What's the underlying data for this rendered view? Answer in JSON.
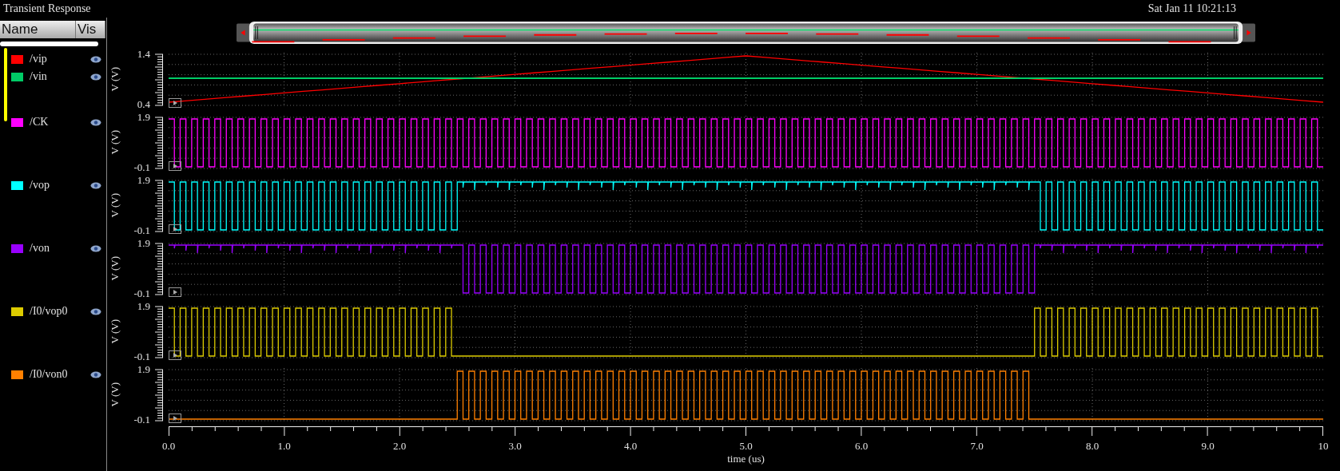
{
  "window": {
    "title": "Transient Response",
    "clock": "Sat Jan 11 10:21:13"
  },
  "sidebar": {
    "columns": [
      "Name",
      "Vis"
    ],
    "groups": [
      {
        "selected": true,
        "signals": [
          {
            "name": "/vip",
            "color": "#ff0000"
          },
          {
            "name": "/vin",
            "color": "#00cc66"
          }
        ]
      },
      {
        "selected": false,
        "signals": [
          {
            "name": "/CK",
            "color": "#ff00ff"
          }
        ]
      },
      {
        "selected": false,
        "signals": [
          {
            "name": "/vop",
            "color": "#00ffff"
          }
        ]
      },
      {
        "selected": false,
        "signals": [
          {
            "name": "/von",
            "color": "#9900ff"
          }
        ]
      },
      {
        "selected": false,
        "signals": [
          {
            "name": "/I0/vop0",
            "color": "#ddcc00"
          }
        ]
      },
      {
        "selected": false,
        "signals": [
          {
            "name": "/I0/von0",
            "color": "#ff8000"
          }
        ]
      }
    ]
  },
  "strips": [
    {
      "kind": "analog",
      "ylabel": "V (V)",
      "ytop": "1.4",
      "ybottom": "0.4",
      "traces": [
        {
          "kind": "ramp",
          "color": "#ff0000"
        },
        {
          "kind": "flat",
          "color": "#00cc66"
        }
      ]
    },
    {
      "kind": "digital",
      "ylabel": "V (V)",
      "ytop": "1.9",
      "ybottom": "-0.1",
      "color": "#ff00ff",
      "outer_toggling": true,
      "middle_toggling": true
    },
    {
      "kind": "digital",
      "ylabel": "V (V)",
      "ytop": "1.9",
      "ybottom": "-0.1",
      "color": "#00ffff",
      "outer_toggling": true,
      "middle_toggling": false,
      "rest_high": true
    },
    {
      "kind": "digital",
      "ylabel": "V (V)",
      "ytop": "1.9",
      "ybottom": "-0.1",
      "color": "#9900ff",
      "outer_toggling": false,
      "middle_toggling": true,
      "rest_high": true
    },
    {
      "kind": "digital",
      "ylabel": "V (V)",
      "ytop": "1.9",
      "ybottom": "-0.1",
      "color": "#ddcc00",
      "outer_toggling": true,
      "middle_toggling": false,
      "rest_high": false
    },
    {
      "kind": "digital",
      "ylabel": "V (V)",
      "ytop": "1.9",
      "ybottom": "-0.1",
      "color": "#ff8000",
      "outer_toggling": false,
      "middle_toggling": true,
      "rest_high": false
    }
  ],
  "x_axis": {
    "ticks": [
      "0.0",
      "1.0",
      "2.0",
      "3.0",
      "4.0",
      "5.0",
      "6.0",
      "7.0",
      "8.0",
      "9.0",
      "10"
    ],
    "label": "time (us)"
  }
}
